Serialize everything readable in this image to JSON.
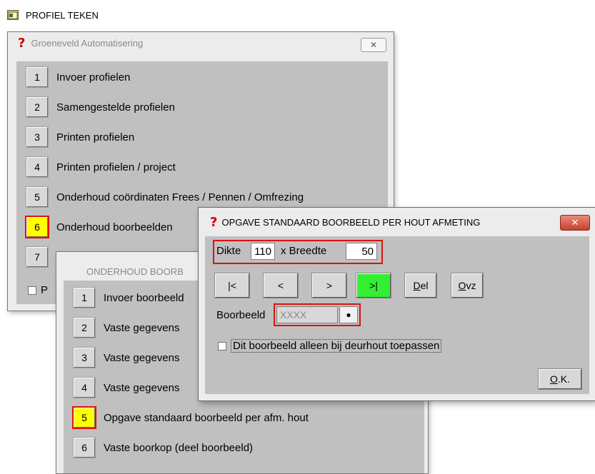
{
  "app": {
    "title": "PROFIEL TEKEN",
    "icon": "app-window-icon"
  },
  "main_window": {
    "title": "Groeneveld Automatisering",
    "close_label": "✕",
    "items": [
      {
        "num": "1",
        "label": "Invoer profielen"
      },
      {
        "num": "2",
        "label": "Samengestelde profielen"
      },
      {
        "num": "3",
        "label": "Printen profielen"
      },
      {
        "num": "4",
        "label": "Printen profielen / project"
      },
      {
        "num": "5",
        "label": "Onderhoud coördinaten Frees / Pennen / Omfrezing"
      },
      {
        "num": "6",
        "label": "Onderhoud boorbeelden",
        "selected": true
      },
      {
        "num": "7",
        "label": ""
      }
    ],
    "checkbox_label": "P"
  },
  "sub_window": {
    "title": "ONDERHOUD BOORB",
    "items": [
      {
        "num": "1",
        "label": "Invoer boorbeeld"
      },
      {
        "num": "2",
        "label": "Vaste gegevens"
      },
      {
        "num": "3",
        "label": "Vaste gegevens"
      },
      {
        "num": "4",
        "label": "Vaste gegevens"
      },
      {
        "num": "5",
        "label": "Opgave standaard boorbeeld per afm. hout",
        "selected": true
      },
      {
        "num": "6",
        "label": "Vaste boorkop (deel boorbeeld)"
      }
    ]
  },
  "dialog": {
    "title": "OPGAVE STANDAARD BOORBEELD PER HOUT AFMETING",
    "close_label": "✕",
    "dikte_label": "Dikte",
    "dikte_value": "110",
    "breedte_label": "x Breedte",
    "breedte_value": "50",
    "nav": {
      "first": "|<",
      "prev": "<",
      "next": ">",
      "last": ">|",
      "del_u": "D",
      "del_rest": "el",
      "ovz_u": "O",
      "ovz_rest": "vz"
    },
    "boorbeeld_label": "Boorbeeld",
    "boorbeeld_value": "XXXX",
    "lookup_symbol": "●",
    "checkbox_label": "Dit boorbeeld alleen bij deurhout toepassen",
    "ok_u": "O",
    "ok_rest": ".K."
  },
  "colors": {
    "selected_bg": "#ffff00",
    "highlight_border": "#e01010",
    "last_btn_bg": "#33ee33"
  }
}
